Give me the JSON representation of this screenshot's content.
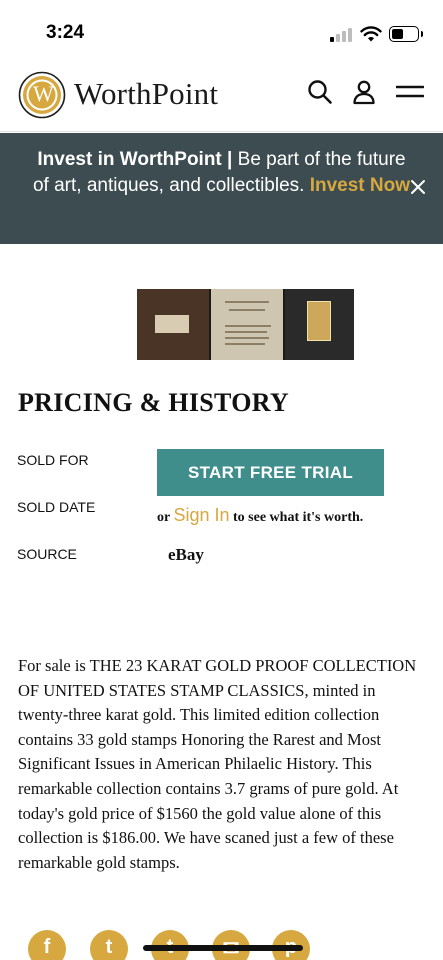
{
  "status": {
    "time": "3:24"
  },
  "header": {
    "brand": "WorthPoint",
    "logo_letter": "W",
    "icons": [
      "search-icon",
      "user-icon",
      "menu-icon"
    ]
  },
  "promo": {
    "title": "Invest in WorthPoint",
    "separator": "|",
    "body": "Be part of the future of art, antiques, and collectibles.",
    "link": "Invest Now"
  },
  "pricing": {
    "title": "PRICING & HISTORY",
    "sold_for_label": "SOLD FOR",
    "sold_date_label": "SOLD DATE",
    "source_label": "SOURCE",
    "trial_button": "START FREE TRIAL",
    "signin_prefix": "or",
    "signin_link": "Sign In",
    "signin_suffix": "to see what it's worth.",
    "source_value": "eBay"
  },
  "description": "For sale is THE 23 KARAT GOLD PROOF COLLECTION OF UNITED STATES STAMP CLASSICS, minted in twenty-three karat gold. This limited edition collection contains 33 gold stamps Honoring the Rarest and Most Significant Issues in American Philaelic History. This remarkable collection contains 3.7 grams of pure gold. At today's gold price of $1560 the gold value alone of this collection is $186.00. We have scaned just a few of these remarkable gold stamps.",
  "share": {
    "buttons": [
      {
        "icon": "facebook-icon",
        "glyph": "f"
      },
      {
        "icon": "twitter-icon",
        "glyph": "t"
      },
      {
        "icon": "tumblr-icon",
        "glyph": "t"
      },
      {
        "icon": "email-icon",
        "glyph": "✉"
      },
      {
        "icon": "pinterest-icon",
        "glyph": "p"
      }
    ]
  },
  "colors": {
    "accent_gold": "#d6a83f",
    "banner_bg": "#3d4c50",
    "button_teal": "#3f8e8c"
  }
}
